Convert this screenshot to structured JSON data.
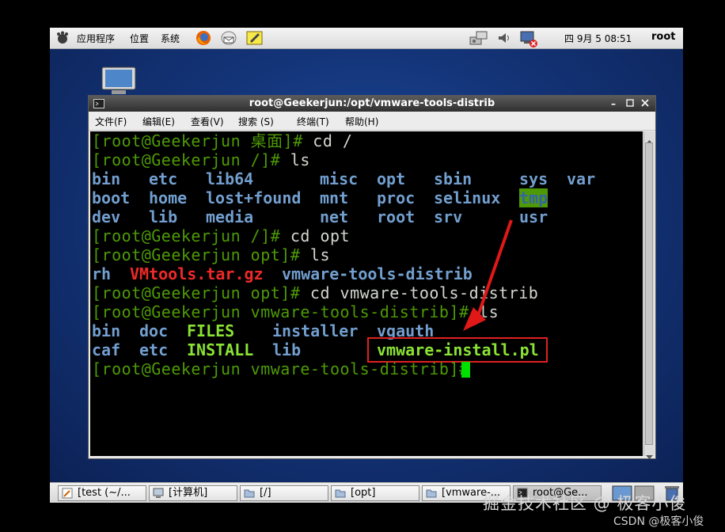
{
  "top_panel": {
    "menus": [
      "应用程序",
      "位置",
      "系统"
    ],
    "clock": "四 9月  5 08:51",
    "user": "root"
  },
  "terminal": {
    "title": "root@Geekerjun:/opt/vmware-tools-distrib",
    "menu": [
      "文件(F)",
      "编辑(E)",
      "查看(V)",
      "搜索 (S)",
      "终端(T)",
      "帮助(H)"
    ],
    "lines": {
      "l1_prompt": "[root@Geekerjun 桌面]# ",
      "l1_cmd": "cd /",
      "l2_prompt": "[root@Geekerjun /]# ",
      "l2_cmd": "ls",
      "l6_prompt": "[root@Geekerjun /]# ",
      "l6_cmd": "cd opt",
      "l7_prompt": "[root@Geekerjun opt]# ",
      "l7_cmd": "ls",
      "l9_prompt": "[root@Geekerjun opt]# ",
      "l9_cmd": "cd vmware-tools-distrib",
      "l10_prompt": "[root@Geekerjun vmware-tools-distrib]# ",
      "l10_cmd": "ls",
      "l13_prompt": "[root@Geekerjun vmware-tools-distrib]# "
    },
    "root_listing": [
      [
        "bin",
        "etc",
        "lib64",
        "misc",
        "opt",
        "sbin",
        "sys",
        "var"
      ],
      [
        "boot",
        "home",
        "lost+found",
        "mnt",
        "proc",
        "selinux",
        "tmp",
        ""
      ],
      [
        "dev",
        "lib",
        "media",
        "net",
        "root",
        "srv",
        "usr",
        ""
      ]
    ],
    "opt_listing": [
      "rh",
      "VMtools.tar.gz",
      "vmware-tools-distrib"
    ],
    "distrib_listing": [
      [
        "bin",
        "doc",
        "FILES",
        "installer",
        "vgauth"
      ],
      [
        "caf",
        "etc",
        "INSTALL",
        "lib",
        "vmware-install.pl"
      ]
    ]
  },
  "taskbar": {
    "items": [
      "[test (~/...",
      "[计算机]",
      "[/]",
      "[opt]",
      "[vmware-...",
      "root@Ge..."
    ]
  },
  "watermark": "掘金技术社区 @ 极客小俊",
  "csdn": "CSDN @极客小俊",
  "colors": {
    "prompt": "#4e9a06",
    "dir": "#729fcf",
    "archive": "#ef2929",
    "exec": "#8ae234",
    "highlight_box": "#e02020",
    "cursor": "#00e000"
  }
}
